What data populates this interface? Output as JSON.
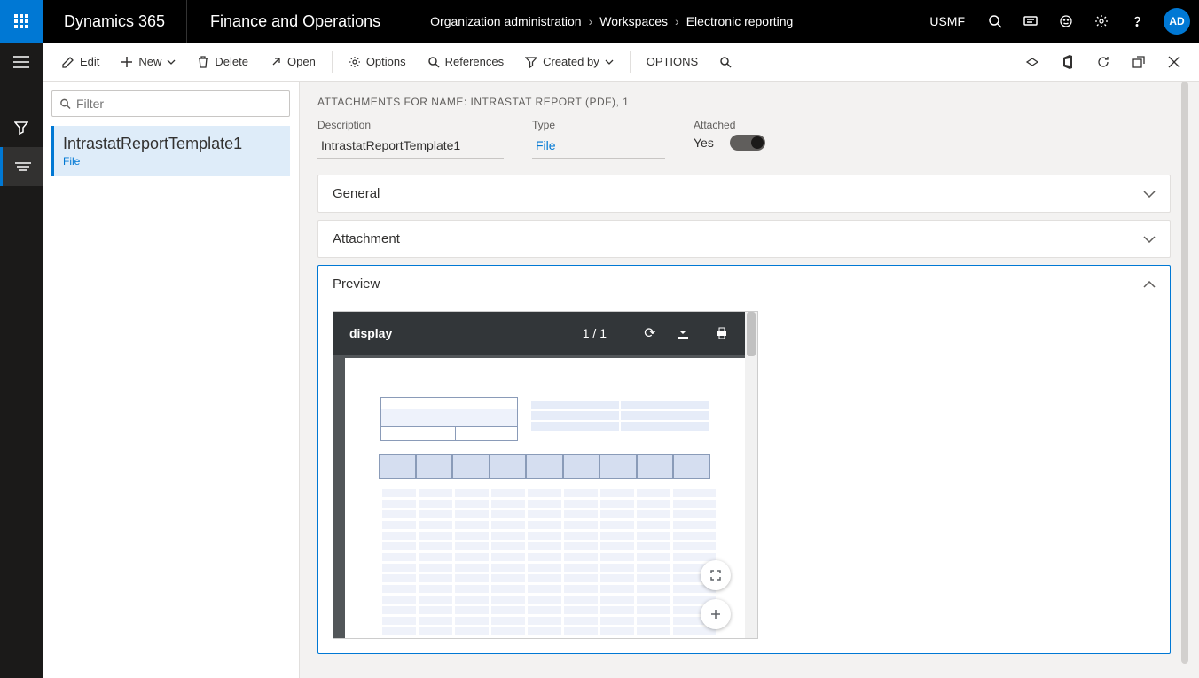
{
  "top": {
    "brand": "Dynamics 365",
    "module": "Finance and Operations",
    "breadcrumb": [
      "Organization administration",
      "Workspaces",
      "Electronic reporting"
    ],
    "company": "USMF",
    "avatar": "AD"
  },
  "actions": {
    "edit": "Edit",
    "new": "New",
    "delete": "Delete",
    "open": "Open",
    "options": "Options",
    "references": "References",
    "created_by": "Created by",
    "options_menu": "OPTIONS"
  },
  "list": {
    "filter_placeholder": "Filter",
    "items": [
      {
        "title": "IntrastatReportTemplate1",
        "sub": "File"
      }
    ]
  },
  "detail": {
    "heading": "ATTACHMENTS FOR NAME: INTRASTAT REPORT (PDF), 1",
    "fields": {
      "description_label": "Description",
      "description_value": "IntrastatReportTemplate1",
      "type_label": "Type",
      "type_value": "File",
      "attached_label": "Attached",
      "attached_value": "Yes"
    },
    "tabs": {
      "general": "General",
      "attachment": "Attachment",
      "preview": "Preview"
    }
  },
  "pdf": {
    "name": "display",
    "pages": "1 / 1"
  }
}
